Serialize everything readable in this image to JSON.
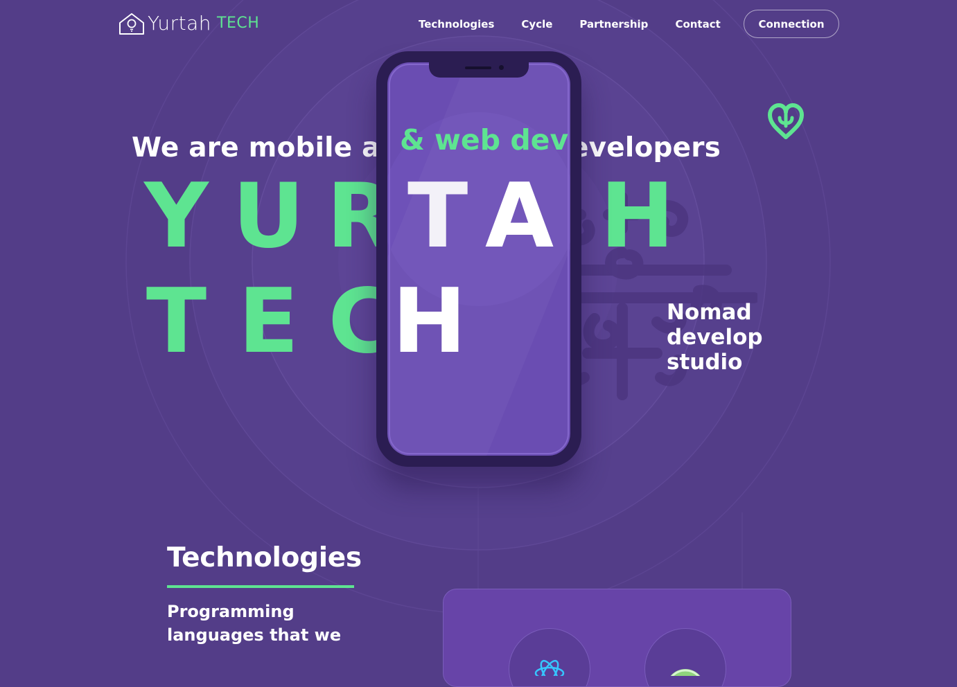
{
  "header": {
    "logo_name": "Yurtah",
    "logo_accent": "TECH",
    "nav": [
      "Technologies",
      "Cycle",
      "Partnership",
      "Contact"
    ],
    "cta_label": "Connection"
  },
  "hero": {
    "tagline": "We are mobile apps & web developers",
    "tagline_overlay": "& web developers",
    "row1": [
      "Y",
      "U",
      "R",
      "T",
      "A",
      "H"
    ],
    "row2": [
      "T",
      "E",
      "C",
      "H"
    ],
    "overlay_letters": [
      "T",
      "A",
      "H"
    ],
    "side_text": [
      "Nomad",
      "develop",
      "studio"
    ]
  },
  "technologies": {
    "title": "Technologies",
    "description": "Programming languages that we"
  },
  "colors": {
    "background": "#533d88",
    "accent": "#5ee491",
    "phone_frame": "#2b1d52",
    "phone_screen": "#6a4db2"
  },
  "icons": [
    "lightbulb-house-icon",
    "heart-ornament-icon",
    "nomad-pattern-icon",
    "react-logo-icon",
    "tech-logo-icon"
  ]
}
